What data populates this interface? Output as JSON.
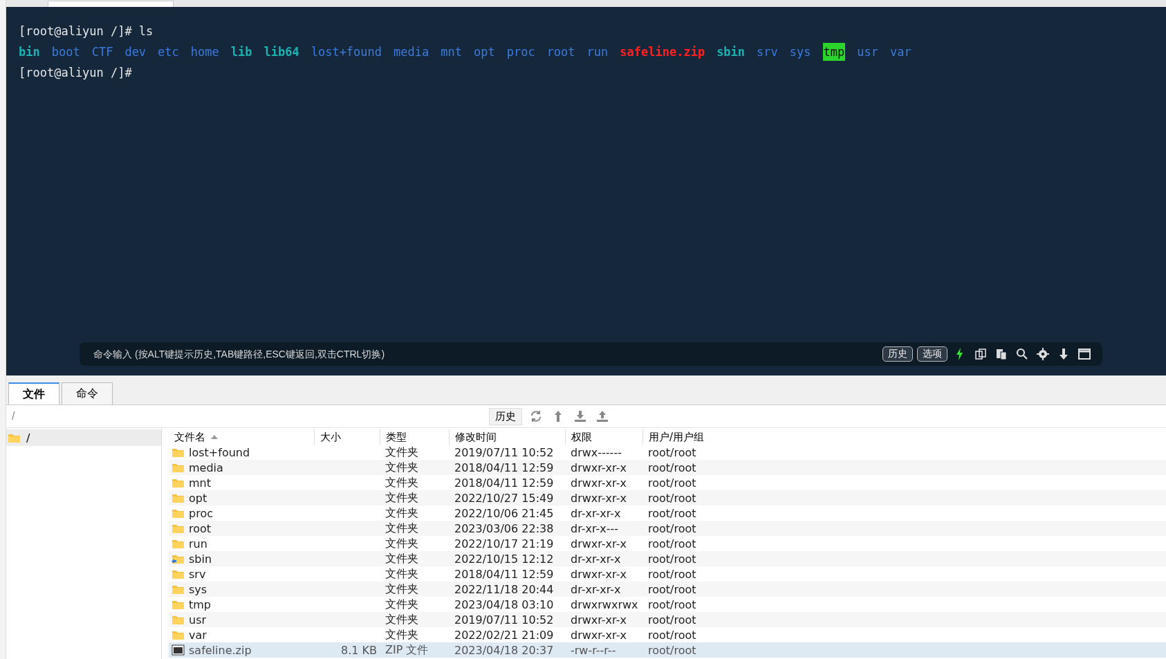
{
  "terminal": {
    "lines": [
      {
        "prompt": "[root@aliyun /]#",
        "command": "ls"
      }
    ],
    "listing": [
      {
        "name": "bin",
        "kind": "link"
      },
      {
        "name": "boot",
        "kind": "dir"
      },
      {
        "name": "CTF",
        "kind": "dir"
      },
      {
        "name": "dev",
        "kind": "dir"
      },
      {
        "name": "etc",
        "kind": "dir"
      },
      {
        "name": "home",
        "kind": "dir"
      },
      {
        "name": "lib",
        "kind": "link"
      },
      {
        "name": "lib64",
        "kind": "link"
      },
      {
        "name": "lost+found",
        "kind": "dir"
      },
      {
        "name": "media",
        "kind": "dir"
      },
      {
        "name": "mnt",
        "kind": "dir"
      },
      {
        "name": "opt",
        "kind": "dir"
      },
      {
        "name": "proc",
        "kind": "dir"
      },
      {
        "name": "root",
        "kind": "dir"
      },
      {
        "name": "run",
        "kind": "dir"
      },
      {
        "name": "safeline.zip",
        "kind": "archive"
      },
      {
        "name": "sbin",
        "kind": "link"
      },
      {
        "name": "srv",
        "kind": "dir"
      },
      {
        "name": "sys",
        "kind": "dir"
      },
      {
        "name": "tmp",
        "kind": "sticky"
      },
      {
        "name": "usr",
        "kind": "dir"
      },
      {
        "name": "var",
        "kind": "dir"
      }
    ],
    "last_prompt": "[root@aliyun /]#"
  },
  "command_bar": {
    "placeholder": "命令输入 (按ALT键提示历史,TAB键路径,ESC键返回,双击CTRL切换)",
    "buttons": [
      "历史",
      "选项"
    ]
  },
  "tabs": [
    {
      "label": "文件",
      "selected": true
    },
    {
      "label": "命令",
      "selected": false
    }
  ],
  "path_bar": {
    "path": "/",
    "history_button": "历史"
  },
  "tree": [
    {
      "label": "/",
      "selected": true
    }
  ],
  "table": {
    "columns": [
      "文件名",
      "大小",
      "类型",
      "修改时间",
      "权限",
      "用户/用户组"
    ],
    "rows": [
      {
        "kind": "folder",
        "name": "lost+found",
        "type": "文件夹",
        "modified": "2019/07/11 10:52",
        "perms": "drwx------",
        "owner": "root/root",
        "selected": false
      },
      {
        "kind": "folder",
        "name": "media",
        "type": "文件夹",
        "modified": "2018/04/11 12:59",
        "perms": "drwxr-xr-x",
        "owner": "root/root",
        "selected": false
      },
      {
        "kind": "folder",
        "name": "mnt",
        "type": "文件夹",
        "modified": "2018/04/11 12:59",
        "perms": "drwxr-xr-x",
        "owner": "root/root",
        "selected": false
      },
      {
        "kind": "folder",
        "name": "opt",
        "type": "文件夹",
        "modified": "2022/10/27 15:49",
        "perms": "drwxr-xr-x",
        "owner": "root/root",
        "selected": false
      },
      {
        "kind": "folder",
        "name": "proc",
        "type": "文件夹",
        "modified": "2022/10/06 21:45",
        "perms": "dr-xr-xr-x",
        "owner": "root/root",
        "selected": false
      },
      {
        "kind": "folder",
        "name": "root",
        "type": "文件夹",
        "modified": "2023/03/06 22:38",
        "perms": "dr-xr-x---",
        "owner": "root/root",
        "selected": false
      },
      {
        "kind": "folder",
        "name": "run",
        "type": "文件夹",
        "modified": "2022/10/17 21:19",
        "perms": "drwxr-xr-x",
        "owner": "root/root",
        "selected": false
      },
      {
        "kind": "link",
        "name": "sbin",
        "type": "文件夹",
        "modified": "2022/10/15 12:12",
        "perms": "dr-xr-xr-x",
        "owner": "root/root",
        "selected": false
      },
      {
        "kind": "folder",
        "name": "srv",
        "type": "文件夹",
        "modified": "2018/04/11 12:59",
        "perms": "drwxr-xr-x",
        "owner": "root/root",
        "selected": false
      },
      {
        "kind": "folder",
        "name": "sys",
        "type": "文件夹",
        "modified": "2022/11/18 20:44",
        "perms": "dr-xr-xr-x",
        "owner": "root/root",
        "selected": false
      },
      {
        "kind": "folder",
        "name": "tmp",
        "type": "文件夹",
        "modified": "2023/04/18 03:10",
        "perms": "drwxrwxrwx",
        "owner": "root/root",
        "selected": false
      },
      {
        "kind": "folder",
        "name": "usr",
        "type": "文件夹",
        "modified": "2019/07/11 10:52",
        "perms": "drwxr-xr-x",
        "owner": "root/root",
        "selected": false
      },
      {
        "kind": "folder",
        "name": "var",
        "type": "文件夹",
        "modified": "2022/02/21 21:09",
        "perms": "drwxr-xr-x",
        "owner": "root/root",
        "selected": false
      },
      {
        "kind": "archive",
        "name": "safeline.zip",
        "size": "8.1 KB",
        "type": "ZIP 文件",
        "modified": "2023/04/18 20:37",
        "perms": "-rw-r--r--",
        "owner": "root/root",
        "selected": true
      }
    ]
  }
}
